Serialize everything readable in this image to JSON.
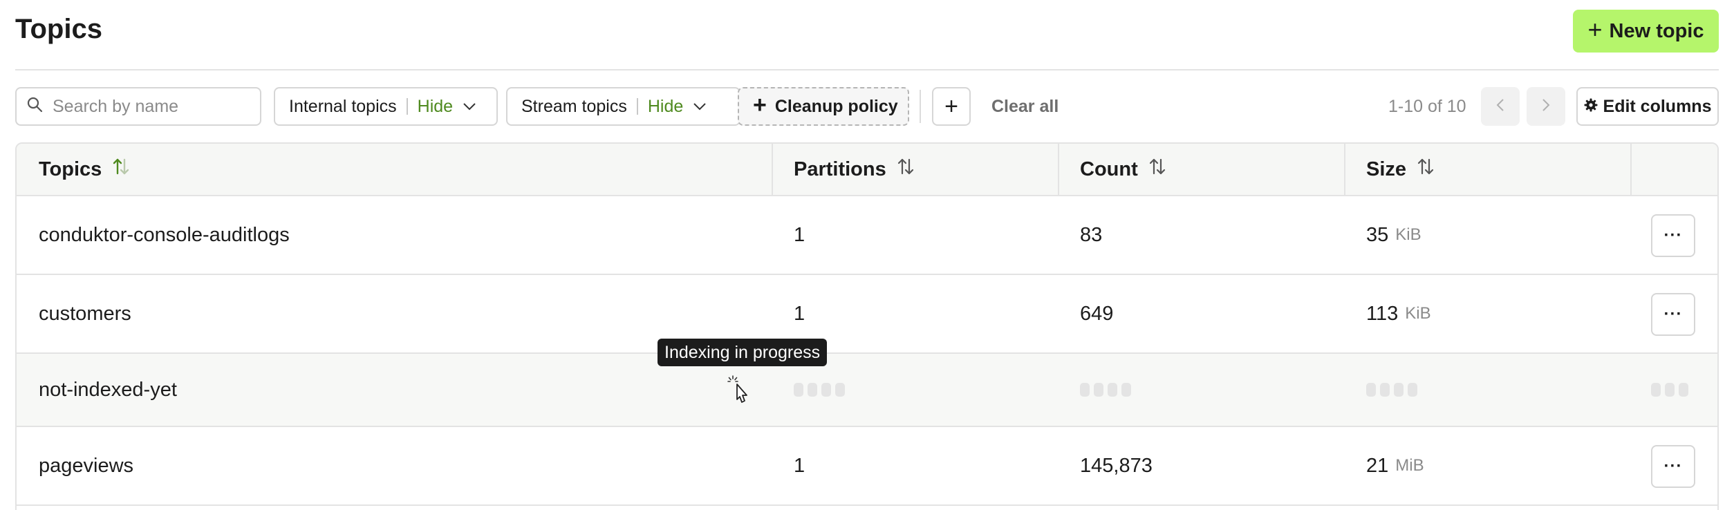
{
  "header": {
    "title": "Topics",
    "new_topic_label": "New topic"
  },
  "toolbar": {
    "search_placeholder": "Search by name",
    "filters": [
      {
        "label": "Internal topics",
        "value": "Hide"
      },
      {
        "label": "Stream topics",
        "value": "Hide"
      }
    ],
    "cleanup_policy_label": "Cleanup policy",
    "clear_all_label": "Clear all",
    "pagination_text": "1-10 of 10",
    "edit_columns_label": "Edit columns"
  },
  "table": {
    "columns": [
      "Topics",
      "Partitions",
      "Count",
      "Size"
    ],
    "rows": [
      {
        "name": "conduktor-console-auditlogs",
        "partitions": "1",
        "count": "83",
        "size": "35",
        "size_unit": "KiB"
      },
      {
        "name": "customers",
        "partitions": "1",
        "count": "649",
        "size": "113",
        "size_unit": "KiB"
      },
      {
        "name": "not-indexed-yet",
        "partitions": "",
        "count": "",
        "size": "",
        "size_unit": ""
      },
      {
        "name": "pageviews",
        "partitions": "1",
        "count": "145,873",
        "size": "21",
        "size_unit": "MiB"
      }
    ],
    "more_button_label": "···"
  },
  "tooltip": {
    "text": "Indexing in progress"
  },
  "colors": {
    "accent": "#b5f56b",
    "filter_value": "#4f8a1f",
    "sort_active": "#4f8a1f"
  },
  "icons": {
    "search": "search-icon",
    "chevron": "chevron-down-icon",
    "plus": "plus-icon",
    "sort": "sort-icon",
    "gear": "gear-icon",
    "loader": "loading-spinner-icon",
    "cursor": "hand-pointer-icon"
  }
}
